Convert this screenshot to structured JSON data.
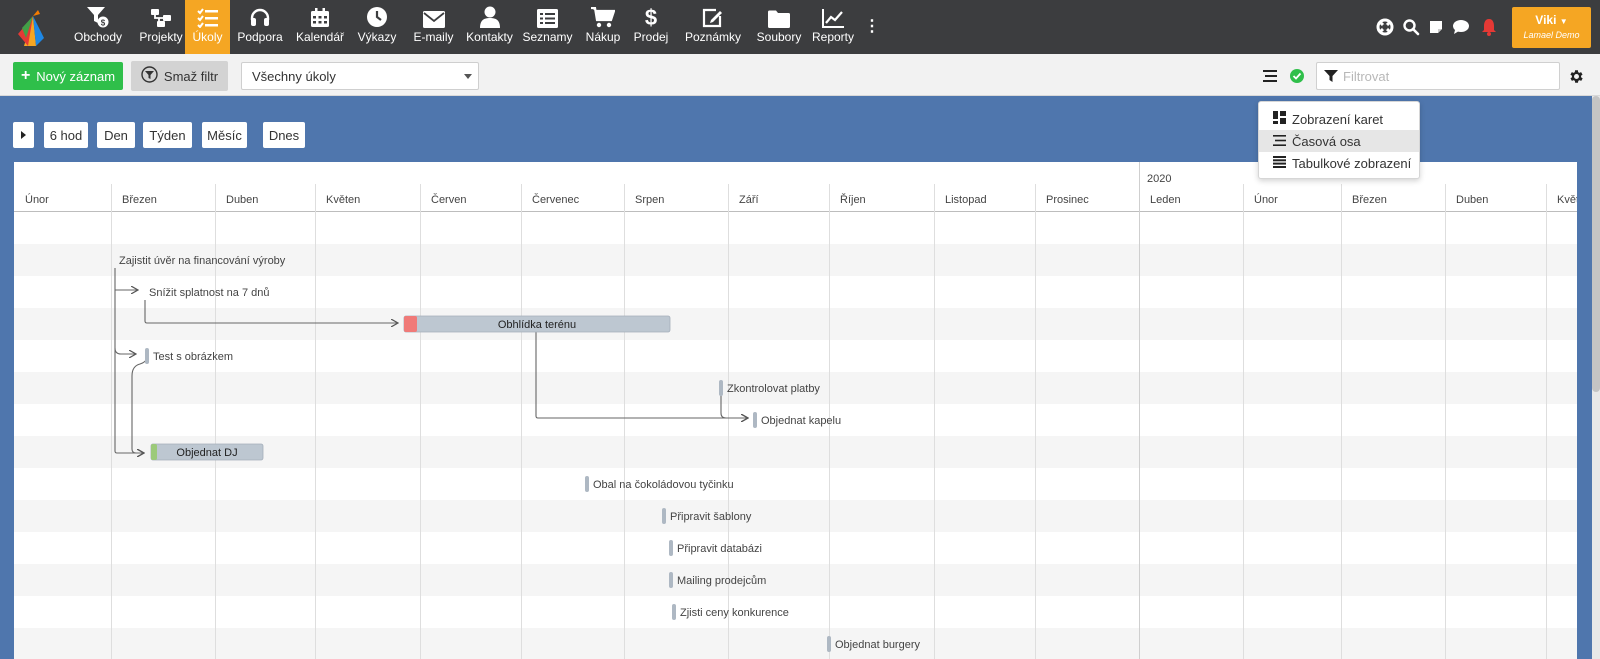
{
  "nav": {
    "items": [
      {
        "label": "Obchody",
        "icon": "funnel-dollar-icon",
        "active": false
      },
      {
        "label": "Projekty",
        "icon": "sitemap-icon",
        "active": false
      },
      {
        "label": "Úkoly",
        "icon": "tasks-icon",
        "active": true
      },
      {
        "label": "Podpora",
        "icon": "headset-icon",
        "active": false
      },
      {
        "label": "Kalendář",
        "icon": "calendar-icon",
        "active": false
      },
      {
        "label": "Výkazy",
        "icon": "clock-icon",
        "active": false
      },
      {
        "label": "E-maily",
        "icon": "envelope-icon",
        "active": false
      },
      {
        "label": "Kontakty",
        "icon": "user-icon",
        "active": false
      },
      {
        "label": "Seznamy",
        "icon": "list-icon",
        "active": false
      },
      {
        "label": "Nákup",
        "icon": "cart-icon",
        "active": false
      },
      {
        "label": "Prodej",
        "icon": "dollar-icon",
        "active": false
      },
      {
        "label": "Poznámky",
        "icon": "edit-icon",
        "active": false
      },
      {
        "label": "Soubory",
        "icon": "folder-icon",
        "active": false
      },
      {
        "label": "Reporty",
        "icon": "chart-line-icon",
        "active": false
      }
    ],
    "more_icon": "⋮",
    "user": {
      "name": "Viki",
      "company": "Lamael Demo"
    },
    "accent": "#f5a623"
  },
  "toolbar": {
    "new_label": "Nový záznam",
    "clear_filter_label": "Smaž filtr",
    "select_value": "Všechny úkoly",
    "filter_placeholder": "Filtrovat"
  },
  "view_menu": {
    "items": [
      {
        "label": "Zobrazení karet",
        "icon": "th-large-icon",
        "selected": false
      },
      {
        "label": "Časová osa",
        "icon": "align-left-icon",
        "selected": true
      },
      {
        "label": "Tabulkové zobrazení",
        "icon": "table-icon",
        "selected": false
      }
    ]
  },
  "zoom": {
    "expand_icon": "caret-right-icon",
    "buttons": [
      "6 hod",
      "Den",
      "Týden",
      "Měsíc"
    ],
    "today_label": "Dnes"
  },
  "timeline": {
    "year_label": "2020",
    "months": [
      "Únor",
      "Březen",
      "Duben",
      "Květen",
      "Červen",
      "Červenec",
      "Srpen",
      "Září",
      "Říjen",
      "Listopad",
      "Prosinec",
      "Leden",
      "Únor",
      "Březen",
      "Duben",
      "Květe"
    ],
    "tasks": [
      {
        "name": "Zajistit úvěr na financování výroby"
      },
      {
        "name": "Snížit splatnost na 7 dnů"
      },
      {
        "name": "Obhlídka terénu"
      },
      {
        "name": "Test s obrázkem"
      },
      {
        "name": "Zkontrolovat platby"
      },
      {
        "name": "Objednat kapelu"
      },
      {
        "name": "Objednat DJ"
      },
      {
        "name": "Obal na čokoládovou tyčinku"
      },
      {
        "name": "Připravit šablony"
      },
      {
        "name": "Připravit databázi"
      },
      {
        "name": "Mailing prodejcům"
      },
      {
        "name": "Zjisti ceny konkurence"
      },
      {
        "name": "Objednat burgery"
      }
    ]
  }
}
